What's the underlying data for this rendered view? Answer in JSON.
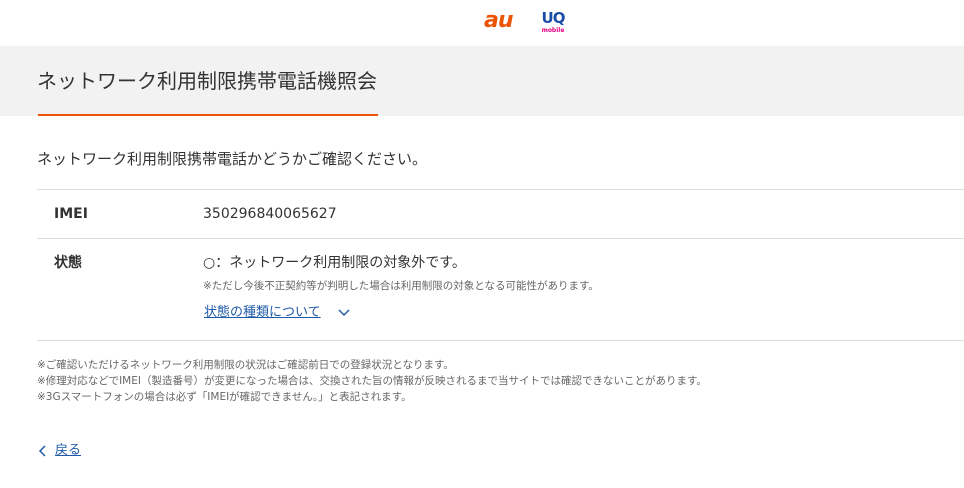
{
  "header": {
    "logo_au": "au",
    "logo_uq": "UQ",
    "logo_uq_sub": "mobile",
    "accent_color": "#eb5505"
  },
  "title": "ネットワーク利用制限携帯電話機照会",
  "intro": "ネットワーク利用制限携帯電話かどうかご確認ください。",
  "result": {
    "imei_label": "IMEI",
    "imei_value": "350296840065627",
    "status_label": "状態",
    "status_value": "○：ネットワーク利用制限の対象外です。",
    "status_note": "※ただし今後不正契約等が判明した場合は利用制限の対象となる可能性があります。",
    "status_types_link": "状態の種類について",
    "status_types_icon": "chevron-down-icon"
  },
  "notes": [
    "※ご確認いただけるネットワーク利用制限の状況はご確認前日での登録状況となります。",
    "※修理対応などでIMEI（製造番号）が変更になった場合は、交換された旨の情報が反映されるまで当サイトでは確認できないことがあります。",
    "※3Gスマートフォンの場合は必ず「IMEIが確認できません。」と表記されます。"
  ],
  "back": {
    "label": "戻る",
    "icon": "chevron-left-icon",
    "link_color": "#1e5aa8"
  }
}
